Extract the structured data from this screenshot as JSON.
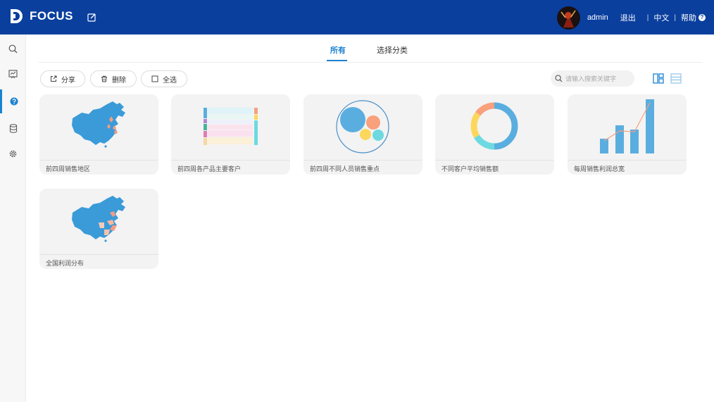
{
  "header": {
    "brand": "FOCUS",
    "user_name": "admin",
    "logout": "退出",
    "language": "中文",
    "help": "帮助",
    "separator": "|",
    "help_icon_glyph": "?",
    "bg_color": "#0a3f9e"
  },
  "sidebar": {
    "items": [
      {
        "icon": "search-icon",
        "active": false
      },
      {
        "icon": "dashboard-icon",
        "active": false
      },
      {
        "icon": "question-icon",
        "active": true
      },
      {
        "icon": "database-icon",
        "active": false
      },
      {
        "icon": "gear-icon",
        "active": false
      }
    ]
  },
  "tabs": [
    {
      "label": "所有",
      "active": true
    },
    {
      "label": "选择分类",
      "active": false
    }
  ],
  "toolbar": {
    "share_label": "分享",
    "delete_label": "删除",
    "select_all_label": "全选",
    "search_placeholder": "请输入搜索关键字"
  },
  "cards": [
    {
      "title": "前四周销售地区",
      "thumb": "china-map-pins"
    },
    {
      "title": "前四周各产品主要客户",
      "thumb": "horizontal-bands"
    },
    {
      "title": "前四周不同人员销售重点",
      "thumb": "bubble-chart"
    },
    {
      "title": "不同客户平均销售额",
      "thumb": "donut-chart"
    },
    {
      "title": "每周销售利润总宽",
      "thumb": "bar-line-chart"
    },
    {
      "title": "全国利润分布",
      "thumb": "china-map-heat"
    }
  ],
  "colors": {
    "accent": "#1b82d2",
    "chart_blue": "#5aaedf",
    "chart_orange": "#f9a07d",
    "chart_yellow": "#fcd75c",
    "chart_cyan": "#6dd9e0"
  }
}
